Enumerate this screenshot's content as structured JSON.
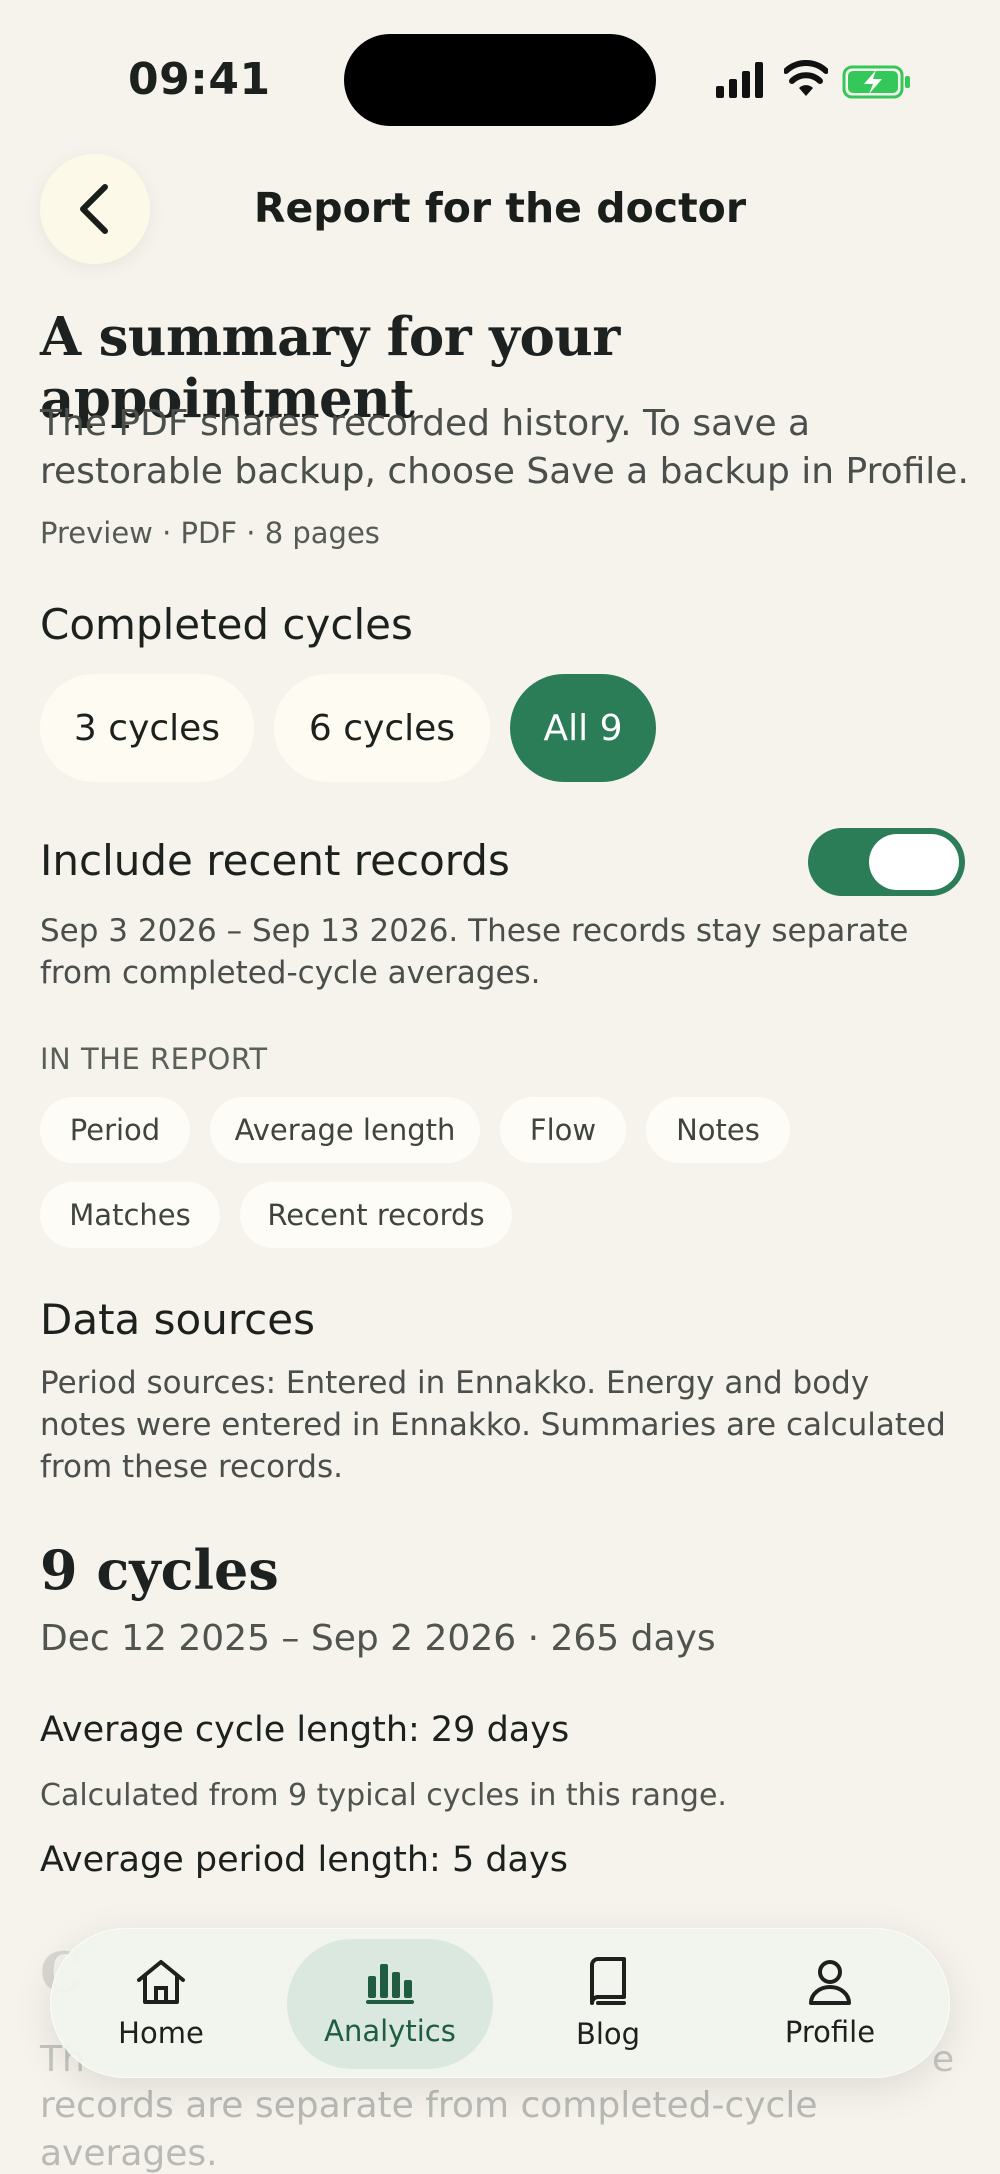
{
  "status_bar": {
    "time": "09:41"
  },
  "header": {
    "title": "Report for the doctor"
  },
  "page": {
    "heading": "A summary for your appointment",
    "intro": "The PDF shares recorded history. To save a restorable backup, choose Save a backup in Profile.",
    "meta": "Preview · PDF · 8 pages"
  },
  "completed_cycles": {
    "title": "Completed cycles",
    "options": [
      "3 cycles",
      "6 cycles",
      "All 9"
    ],
    "selected": "All 9"
  },
  "recent_records": {
    "title": "Include recent records",
    "enabled": true,
    "description": "Sep 3 2026 – Sep 13 2026. These records stay separate from completed-cycle averages."
  },
  "in_report": {
    "label": "IN THE REPORT",
    "tags": [
      "Period",
      "Average length",
      "Flow",
      "Notes",
      "Matches",
      "Recent records"
    ]
  },
  "data_sources": {
    "title": "Data sources",
    "text": "Period sources: Entered in Ennakko. Energy and body notes were entered in Ennakko. Summaries are calculated from these records."
  },
  "summary": {
    "heading": "9 cycles",
    "range": "Dec 12 2025 – Sep 2 2026 · 265 days",
    "avg_cycle": "Average cycle length: 29 days",
    "avg_cycle_note": "Calculated from 9 typical cycles in this range.",
    "avg_period": "Average period length: 5 days"
  },
  "under_tabbar": {
    "heading": "C",
    "text_start": "Th",
    "text_end": "e",
    "text_line2": "records are separate from completed-cycle",
    "text_line3": "averages."
  },
  "tabbar": {
    "tabs": [
      {
        "label": "Home",
        "icon": "home-icon"
      },
      {
        "label": "Analytics",
        "icon": "bar-chart-icon"
      },
      {
        "label": "Blog",
        "icon": "book-icon"
      },
      {
        "label": "Profile",
        "icon": "person-icon"
      }
    ],
    "active": "Analytics"
  },
  "colors": {
    "background": "#f6f3ec",
    "accent": "#2b7d57",
    "chip": "#fefcf2",
    "battery": "#34c759"
  }
}
